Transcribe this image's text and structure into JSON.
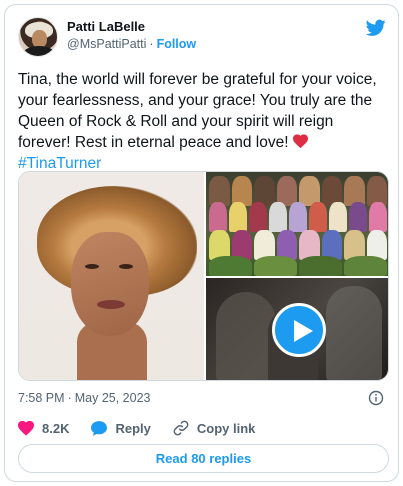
{
  "author": {
    "display_name": "Patti LaBelle",
    "handle": "@MsPattiPatti",
    "separator": "·",
    "follow_label": "Follow"
  },
  "tweet": {
    "text": "Tina, the world will forever be grateful for your voice, your fearlessness, and your grace! You truly are the Queen of Rock & Roll and your spirit will reign forever! Rest in eternal peace and love!",
    "hashtag": "#TinaTurner"
  },
  "meta": {
    "time": "7:58 PM",
    "separator": "·",
    "date": "May 25, 2023"
  },
  "actions": {
    "likes": "8.2K",
    "reply_label": "Reply",
    "copy_label": "Copy link"
  },
  "read_replies_label": "Read 80 replies",
  "colors": {
    "accent": "#1d9bf0",
    "like": "#f91880",
    "muted": "#536471",
    "text": "#0f1419"
  },
  "icons": {
    "brand": "twitter-bird-icon",
    "video": "play-icon",
    "like": "heart-icon",
    "reply": "reply-bubble-icon",
    "copy": "link-icon",
    "info": "info-icon"
  }
}
